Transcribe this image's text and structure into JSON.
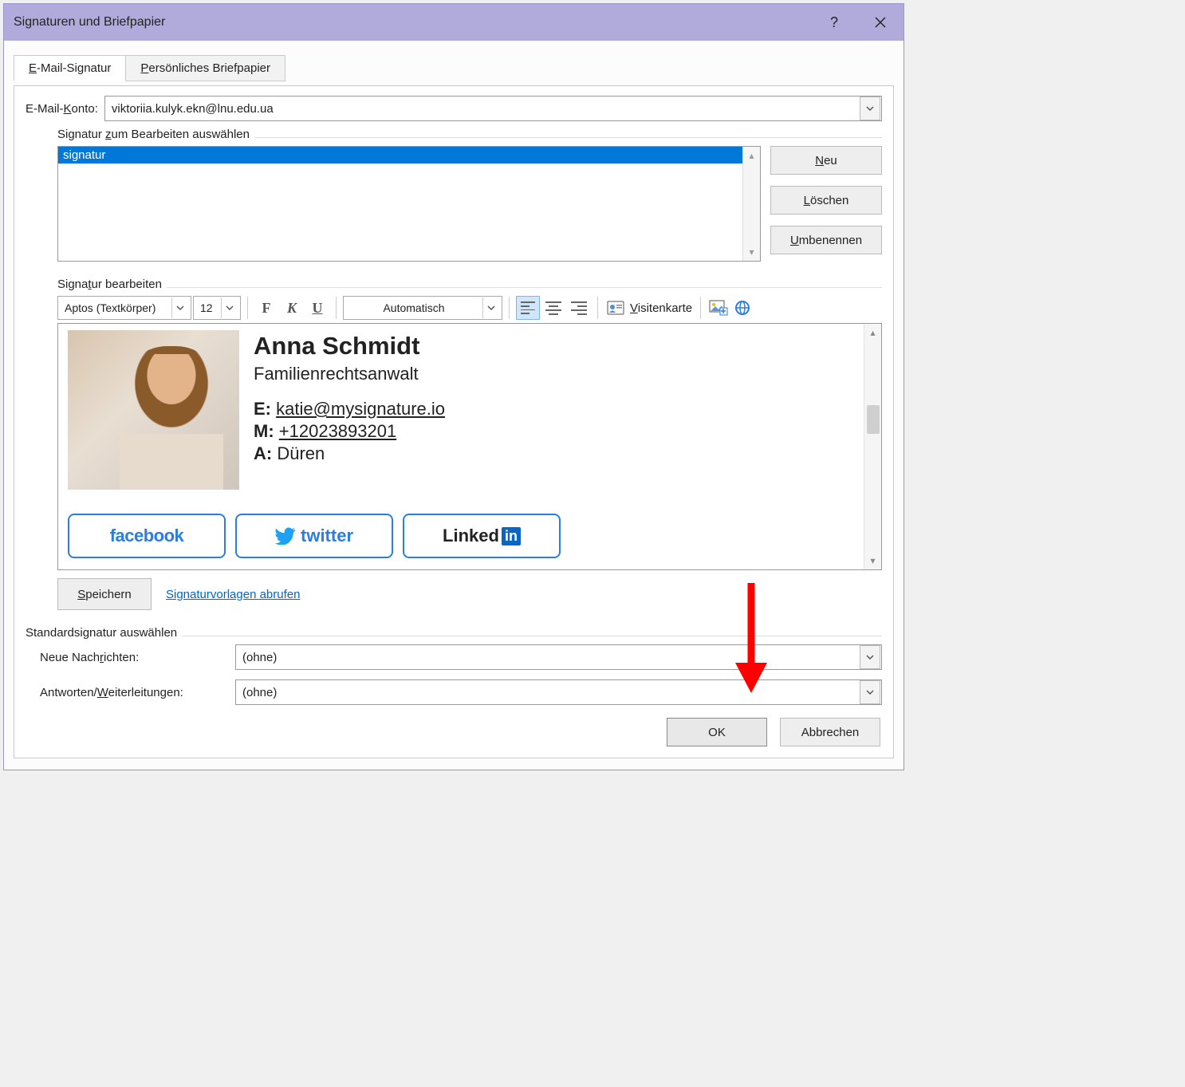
{
  "titlebar": {
    "title": "Signaturen und Briefpapier"
  },
  "tabs": {
    "email": {
      "prefix": "E",
      "rest": "-Mail-Signatur"
    },
    "personal": {
      "prefix": "P",
      "rest": "ersönliches Briefpapier"
    }
  },
  "account": {
    "label_prefix": "E-Mail-",
    "label_u": "K",
    "label_rest": "onto:",
    "value": "viktoriia.kulyk.ekn@lnu.edu.ua"
  },
  "select_signature": {
    "title_prefix": "Signatur ",
    "title_u": "z",
    "title_rest": "um Bearbeiten auswählen",
    "items": [
      "signatur"
    ],
    "buttons": {
      "neu_u": "N",
      "neu_rest": "eu",
      "loeschen_u": "L",
      "loeschen_rest": "öschen",
      "umbenennen_u": "U",
      "umbenennen_rest": "mbenennen"
    }
  },
  "edit_signature": {
    "title_prefix": "Signa",
    "title_u": "t",
    "title_rest": "ur bearbeiten"
  },
  "toolbar": {
    "font": "Aptos (Textkörper)",
    "size": "12",
    "bold": "F",
    "italic": "K",
    "underline": "U",
    "color": "Automatisch",
    "vcard_u": "V",
    "vcard_rest": "isitenkarte"
  },
  "signature": {
    "name": "Anna Schmidt",
    "role": "Familienrechtsanwalt",
    "email_label": "E:",
    "email": "katie@mysignature.io",
    "phone_label": "M:",
    "phone": "+12023893201",
    "address_label": "A:",
    "address": "Düren",
    "socials": {
      "facebook": "facebook",
      "twitter_pre": "🐦 ",
      "twitter": "twitter",
      "linkedin_pre": "Linked",
      "linkedin_box": "in"
    }
  },
  "save": {
    "button_u": "S",
    "button_rest": "peichern",
    "link": "Signaturvorlagen abrufen"
  },
  "defaults": {
    "title": "Standardsignatur auswählen",
    "new_label_pre": "Neue Nach",
    "new_label_u": "r",
    "new_label_post": "ichten:",
    "new_value": "(ohne)",
    "reply_label_pre": "Antworten/",
    "reply_label_u": "W",
    "reply_label_post": "eiterleitungen:",
    "reply_value": "(ohne)"
  },
  "footer": {
    "ok": "OK",
    "cancel": "Abbrechen"
  }
}
